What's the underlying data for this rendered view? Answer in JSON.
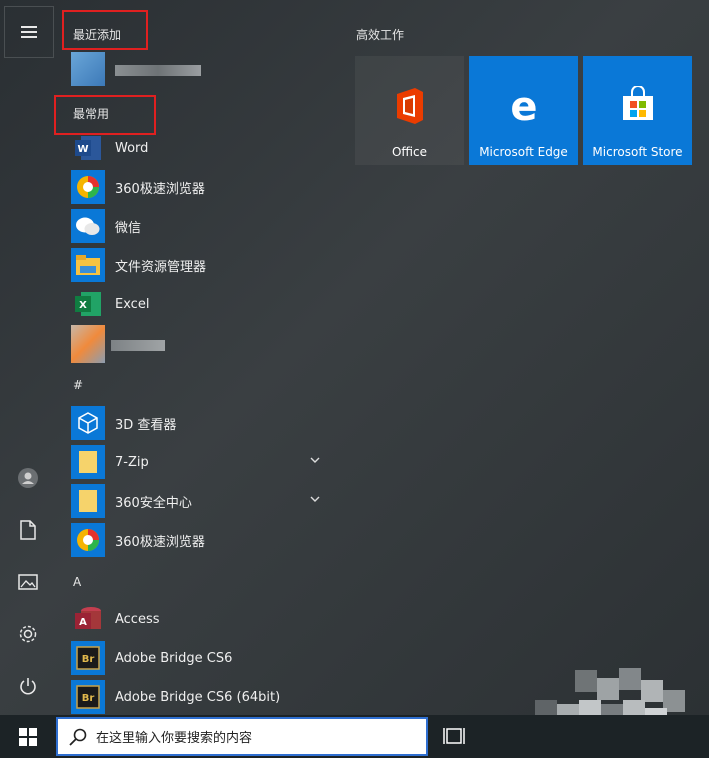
{
  "left": {
    "recent_header": "最近添加",
    "frequent_header": "最常用",
    "frequent": [
      {
        "label": "Word",
        "icon": "word-icon"
      },
      {
        "label": "360极速浏览器",
        "icon": "360-browser-icon"
      },
      {
        "label": "微信",
        "icon": "wechat-icon"
      },
      {
        "label": "文件资源管理器",
        "icon": "file-explorer-icon"
      },
      {
        "label": "Excel",
        "icon": "excel-icon"
      }
    ],
    "hash_header": "#",
    "hash_items": [
      {
        "label": "3D 查看器",
        "icon": "3d-viewer-icon"
      },
      {
        "label": "7-Zip",
        "icon": "folder-icon"
      },
      {
        "label": "360安全中心",
        "icon": "folder-icon"
      },
      {
        "label": "360极速浏览器",
        "icon": "360-browser-icon"
      }
    ],
    "a_header": "A",
    "a_items": [
      {
        "label": "Access",
        "icon": "access-icon"
      },
      {
        "label": "Adobe Bridge CS6",
        "icon": "adobe-bridge-icon"
      },
      {
        "label": "Adobe Bridge CS6 (64bit)",
        "icon": "adobe-bridge-icon"
      }
    ]
  },
  "tiles": {
    "header": "高效工作",
    "items": [
      {
        "label": "Office"
      },
      {
        "label": "Microsoft Edge"
      },
      {
        "label": "Microsoft Store"
      }
    ]
  },
  "taskbar": {
    "search_placeholder": "在这里输入你要搜索的内容"
  },
  "colors": {
    "accent": "#0a78d7",
    "highlight_box": "#e02020"
  }
}
